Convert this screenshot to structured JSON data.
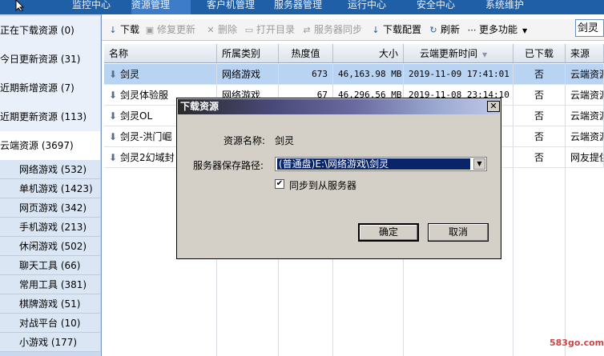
{
  "topnav": {
    "tabs": [
      {
        "label": "监控中心",
        "active": false
      },
      {
        "label": "资源管理",
        "active": true
      },
      {
        "label": "客户机管理",
        "active": false
      },
      {
        "label": "服务器管理",
        "active": false
      },
      {
        "label": "运行中心",
        "active": false
      },
      {
        "label": "安全中心",
        "active": false
      },
      {
        "label": "系统维护",
        "active": false
      }
    ]
  },
  "sidebar": {
    "main": [
      {
        "label": "正在下载资源 (0)"
      },
      {
        "label": "今日更新资源 (31)"
      },
      {
        "label": "近期新增资源 (7)"
      },
      {
        "label": "近期更新资源 (113)"
      },
      {
        "label": "云端资源 (3697)"
      }
    ],
    "sub": [
      {
        "label": "网络游戏 (532)"
      },
      {
        "label": "单机游戏 (1423)"
      },
      {
        "label": "网页游戏 (342)"
      },
      {
        "label": "手机游戏 (213)"
      },
      {
        "label": "休闲游戏 (502)"
      },
      {
        "label": "聊天工具 (66)"
      },
      {
        "label": "常用工具 (381)"
      },
      {
        "label": "棋牌游戏 (51)"
      },
      {
        "label": "对战平台 (10)"
      },
      {
        "label": "小游戏 (177)"
      }
    ]
  },
  "toolbar": {
    "download": "下载",
    "repair": "修复更新",
    "delete": "删除",
    "open_dir": "打开目录",
    "server_sync": "服务器同步",
    "download_config": "下载配置",
    "refresh": "刷新",
    "more": "更多功能",
    "search_value": "剑灵"
  },
  "table": {
    "headers": [
      "名称",
      "所属类别",
      "热度值",
      "大小",
      "云端更新时间",
      "已下载",
      "来源"
    ],
    "rows": [
      [
        "剑灵",
        "网络游戏",
        "673",
        "46,163.98 MB",
        "2019-11-09 17:41:01",
        "否",
        "云端资源"
      ],
      [
        "剑灵体验服",
        "网络游戏",
        "67",
        "46,296.56 MB",
        "2019-11-08 23:14:10",
        "否",
        "云端资源"
      ],
      [
        "剑灵OL",
        "",
        "",
        "",
        "",
        "否",
        "云端资源"
      ],
      [
        "剑灵-洪门崛",
        "",
        "",
        "",
        "",
        "否",
        "云端资源"
      ],
      [
        "剑灵2幻域封",
        "",
        "",
        "",
        "",
        "否",
        "网友提供"
      ]
    ]
  },
  "dialog": {
    "title": "下载资源",
    "close": "✕",
    "resource_label": "资源名称:",
    "resource_value": "剑灵",
    "path_label": "服务器保存路径:",
    "path_value": "(普通盘)E:\\网络游戏\\剑灵",
    "sync_label": "同步到从服务器",
    "sync_checked": true,
    "ok": "确定",
    "cancel": "取消"
  },
  "watermark": "583go.com",
  "colors": {
    "nav": "#1f5fa8",
    "selected_row": "#b9d3f3",
    "dialog_bg": "#d4d0c8",
    "select_highlight": "#0a246a"
  }
}
